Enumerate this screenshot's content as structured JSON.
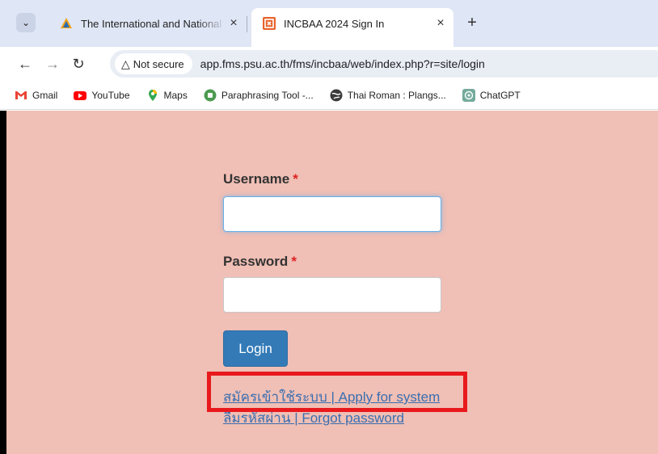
{
  "browser": {
    "tabs": [
      {
        "title": "The International and National Conference",
        "active": false,
        "close": "×"
      },
      {
        "title": "INCBAA 2024 Sign In",
        "active": true,
        "close": "×"
      }
    ],
    "new_tab": "+",
    "security_label": "Not secure",
    "url": "app.fms.psu.ac.th/fms/incbaa/web/index.php?r=site/login",
    "bookmarks": [
      {
        "label": "Gmail",
        "icon": "gmail-icon"
      },
      {
        "label": "YouTube",
        "icon": "youtube-icon"
      },
      {
        "label": "Maps",
        "icon": "maps-icon"
      },
      {
        "label": "Paraphrasing Tool -...",
        "icon": "paraphrasing-icon"
      },
      {
        "label": "Thai Roman : Plangs...",
        "icon": "globe-icon"
      },
      {
        "label": "ChatGPT",
        "icon": "chatgpt-icon"
      }
    ]
  },
  "form": {
    "username_label": "Username",
    "password_label": "Password",
    "required_mark": "*",
    "username_value": "",
    "password_value": "",
    "login_label": "Login"
  },
  "links": {
    "apply": "สมัครเข้าใช้ระบบ | Apply for system",
    "forgot": "ลืมรหัสผ่าน | Forgot password"
  },
  "colors": {
    "page_background": "#f0bfb5",
    "login_button": "#337ab7",
    "highlight": "#e8191d",
    "link": "#3a6fb0"
  }
}
